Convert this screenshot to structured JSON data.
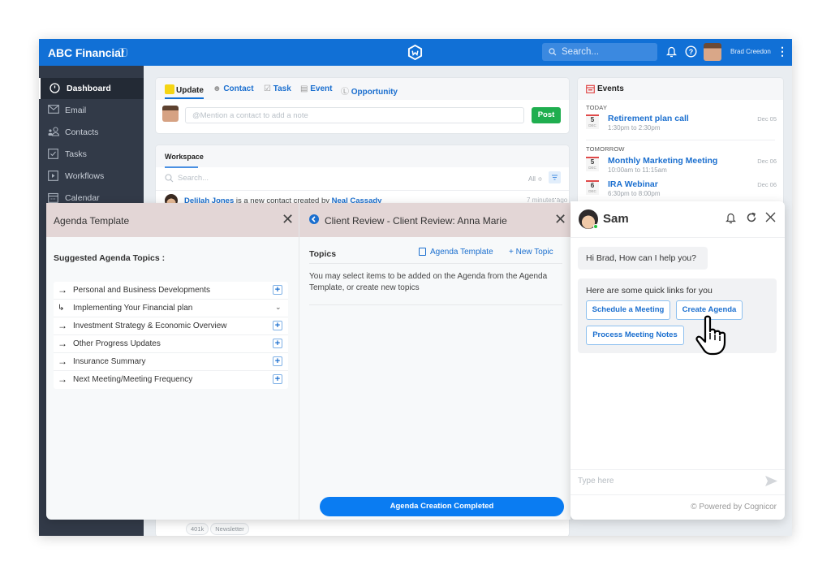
{
  "topbar": {
    "brand": "ABC Financial",
    "brand_caret": "▾",
    "search_placeholder": "Search...",
    "user_name": "Brad Creedon",
    "kebab": "⋮"
  },
  "sidebar": {
    "items": [
      {
        "label": "Dashboard",
        "icon": "dashboard-icon"
      },
      {
        "label": "Email",
        "icon": "email-icon"
      },
      {
        "label": "Contacts",
        "icon": "contacts-icon"
      },
      {
        "label": "Tasks",
        "icon": "tasks-icon"
      },
      {
        "label": "Workflows",
        "icon": "workflows-icon"
      },
      {
        "label": "Calendar",
        "icon": "calendar-icon"
      }
    ],
    "collapse": "≡‹"
  },
  "composer": {
    "tabs": [
      "Update",
      "Contact",
      "Task",
      "Event",
      "Opportunity"
    ],
    "placeholder": "@Mention a contact to add a note",
    "post": "Post"
  },
  "workspace": {
    "title": "Workspace",
    "search_placeholder": "Search...",
    "filter_all": "All ≑",
    "feed": {
      "contact": "Delilah Jones",
      "text": " is a new contact created by ",
      "creator": "Neal Cassady",
      "time": "7 minutes ago",
      "more": "···"
    },
    "tags": [
      "401k",
      "Newsletter"
    ]
  },
  "events": {
    "title": "Events",
    "groups": [
      {
        "label": "TODAY"
      },
      {
        "label": "TOMORROW"
      }
    ],
    "items": [
      {
        "day": "5",
        "month": "DEC",
        "name": "Retirement plan call",
        "time": "1:30pm to 2:30pm",
        "date": "Dec 05"
      },
      {
        "day": "5",
        "month": "DEC",
        "name": "Monthly Marketing Meeting",
        "time": "10:00am to 11:15am",
        "date": "Dec 06"
      },
      {
        "day": "6",
        "month": "DEC",
        "name": "IRA Webinar",
        "time": "6:30pm to 8:00pm",
        "date": "Dec 06"
      }
    ]
  },
  "agenda_template": {
    "title": "Agenda Template",
    "close": "✕",
    "subtitle": "Suggested Agenda Topics :",
    "topics": [
      {
        "label": "Personal and Business Developments",
        "kind": "add"
      },
      {
        "label": "Implementing Your Financial plan",
        "kind": "expand"
      },
      {
        "label": "Investment Strategy & Economic Overview",
        "kind": "add"
      },
      {
        "label": "Other Progress Updates",
        "kind": "add"
      },
      {
        "label": "Insurance Summary",
        "kind": "add"
      },
      {
        "label": "Next Meeting/Meeting Frequency",
        "kind": "add"
      }
    ],
    "arrow": "→",
    "plus": "+",
    "chevron": "⌄"
  },
  "client_review": {
    "title": "Client Review - Client Review: Anna Marie",
    "close": "✕",
    "topics_label": "Topics",
    "agenda_template_link": "Agenda Template",
    "new_topic_link": "+ New Topic",
    "description": "You may select items to be added on the Agenda from the Agenda Template, or create new topics",
    "complete_button": "Agenda Creation Completed"
  },
  "chat": {
    "name": "Sam",
    "greeting": "Hi Brad, How can I help you?",
    "quick_intro": "Here are some quick links for you",
    "quick_links": [
      "Schedule a Meeting",
      "Create Agenda",
      "Process Meeting Notes"
    ],
    "input_placeholder": "Type here",
    "powered_by": "© Powered by Cognicor",
    "refresh": "C",
    "close": "✕"
  },
  "colors": {
    "primary": "#1170d6",
    "sidebar": "#323a48",
    "post": "#1fae4f",
    "complete": "#0a7cf2",
    "pane_header": "#e3d6d6"
  }
}
